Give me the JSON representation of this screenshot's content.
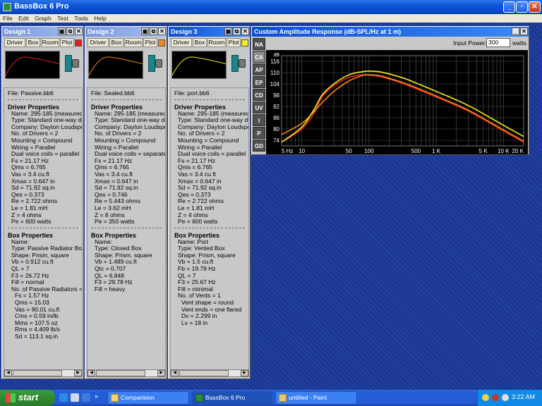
{
  "window": {
    "title": "BassBox 6 Pro"
  },
  "menu": [
    "File",
    "Edit",
    "Graph",
    "Test",
    "Tools",
    "Help"
  ],
  "tabs": [
    "Driver",
    "Box",
    "Room",
    "Plot"
  ],
  "colors": {
    "design1": "#e02020",
    "design2": "#f28a1a",
    "design3": "#f4ee25"
  },
  "designs": [
    {
      "title": "Design 1",
      "file": "File:  Passive.bb6",
      "driver_header": "Driver Properties",
      "driver": [
        "Name:  295-185  (measured)",
        "Type:  Standard one-way driver",
        "Company:  Dayton Loudspeaker",
        "No. of Drivers = 2",
        "Mounting = Compound",
        "Wiring = Parallel",
        "Dual voice coils = parallel",
        "Fs = 21.17 Hz",
        "Qms = 6.765",
        "Vas = 3.4 cu.ft",
        "Xmax = 0.647 in",
        "Sd = 71.92 sq.in",
        "Qes = 0.373",
        "Re = 2.722 ohms",
        "Le = 1.81 mH",
        "Z = 4 ohms",
        "Pe = 600 watts"
      ],
      "box_header": "Box Properties",
      "box": [
        "Name:",
        "Type:  Passive Radiator Box",
        "Shape:  Prism, square",
        "Vb = 0.912 cu.ft",
        "QL = 7",
        "F3 = 26.72 Hz",
        "Fill = normal",
        "No. of Passive Radiators = 2"
      ],
      "box_sub": [
        "Fs = 1.57 Hz",
        "Qms = 15.03",
        "Vas = 90.01 cu.ft",
        "Cms = 0.59 in/lb",
        "Mms = 107.5 oz",
        "Rms = 4.409 lb/s",
        "Sd = 113.1 sq.in"
      ]
    },
    {
      "title": "Design 2",
      "file": "File:  Sealed.bb6",
      "driver_header": "Driver Properties",
      "driver": [
        "Name:  295-185  (measured)",
        "Type:  Standard one-way driver",
        "Company:  Dayton Loudspeaker",
        "No. of Drivers = 2",
        "Mounting = Compound",
        "Wiring = Parallel",
        "Dual voice coils = separate",
        "Fs = 21.17 Hz",
        "Qms = 6.765",
        "Vas = 3.4 cu.ft",
        "Xmax = 0.647 in",
        "Sd = 71.92 sq.in",
        "Qes = 0.746",
        "Re = 5.443 ohms",
        "Le = 3.62 mH",
        "Z = 8 ohms",
        "Pe = 350 watts"
      ],
      "box_header": "Box Properties",
      "box": [
        "Name:",
        "Type:  Closed Box",
        "Shape:  Prism, square",
        "Vb = 1.489 cu.ft",
        "Qtc = 0.707",
        "QL = 6.848",
        "F3 = 29.78 Hz",
        "Fill = heavy"
      ],
      "box_sub": []
    },
    {
      "title": "Design 3",
      "file": "File:  port.bb6",
      "driver_header": "Driver Properties",
      "driver": [
        "Name:  295-185  (measured)",
        "Type:  Standard one-way driver",
        "Company:  Dayton Loudspeaker",
        "No. of Drivers = 2",
        "Mounting = Compound",
        "Wiring = Parallel",
        "Dual voice coils = parallel",
        "Fs = 21.17 Hz",
        "Qms = 6.765",
        "Vas = 3.4 cu.ft",
        "Xmax = 0.647 in",
        "Sd = 71.92 sq.in",
        "Qes = 0.373",
        "Re = 2.722 ohms",
        "Le = 1.81 mH",
        "Z = 4 ohms",
        "Pe = 600 watts"
      ],
      "box_header": "Box Properties",
      "box": [
        "Name:  Port",
        "Type:  Vented Box",
        "Shape:  Prism, square",
        "Vb = 1.5 cu.ft",
        "Fb = 19.79 Hz",
        "QL = 7",
        "F3 = 25.67 Hz",
        "Fill = minimal",
        "No. of Vents = 1"
      ],
      "box_sub": [
        "Vent shape = round",
        "Vent ends = one flared",
        "Dv = 2.299 in",
        "Lv = 18 in"
      ]
    }
  ],
  "graph": {
    "title": "Custom Amplitude Response (dB-SPL/Hz at 1 m)",
    "side_buttons": [
      "NA",
      "CA",
      "AP",
      "EP",
      "CD",
      "UV",
      "I",
      "P",
      "GD"
    ],
    "active_button": "CA",
    "input_power_label": "Input Power:",
    "input_power_value": "300",
    "input_power_unit": "watts"
  },
  "chart_data": {
    "type": "line",
    "ylabel": "dB",
    "yticks": [
      74,
      80,
      86,
      92,
      98,
      104,
      110,
      116
    ],
    "ylim": [
      71,
      119
    ],
    "xscale": "log",
    "xlim": [
      5,
      20000
    ],
    "xticks": [
      {
        "v": 5,
        "label": "5 Hz"
      },
      {
        "v": 10,
        "label": "10"
      },
      {
        "v": 50,
        "label": "50"
      },
      {
        "v": 100,
        "label": "100"
      },
      {
        "v": 500,
        "label": "500"
      },
      {
        "v": 1000,
        "label": "1 K"
      },
      {
        "v": 5000,
        "label": "5 K"
      },
      {
        "v": 10000,
        "label": "10 K"
      },
      {
        "v": 20000,
        "label": "20 K"
      }
    ],
    "grid": true,
    "series": [
      {
        "color": "#e02020",
        "x": [
          5,
          10,
          15,
          20,
          30,
          50,
          80,
          100,
          150,
          300,
          500,
          1000,
          3000,
          10000,
          20000
        ],
        "y": [
          73,
          80,
          88,
          97,
          103,
          107.5,
          108.8,
          108.6,
          107.8,
          104.5,
          101.5,
          97,
          89.5,
          79,
          73
        ]
      },
      {
        "color": "#f28a1a",
        "x": [
          5,
          10,
          15,
          20,
          30,
          50,
          80,
          100,
          150,
          300,
          500,
          1000,
          3000,
          10000,
          20000
        ],
        "y": [
          77,
          83,
          89,
          94,
          100,
          105.5,
          108.5,
          108.8,
          108.2,
          105,
          102,
          97.5,
          90,
          79.5,
          73.5
        ]
      },
      {
        "color": "#f4ee25",
        "x": [
          5,
          10,
          15,
          20,
          30,
          50,
          80,
          100,
          150,
          300,
          500,
          1000,
          3000,
          10000,
          20000
        ],
        "y": [
          73,
          81,
          90,
          98,
          104,
          108.8,
          110.5,
          110.8,
          110.3,
          107.5,
          104.5,
          100,
          92.5,
          82,
          76
        ]
      }
    ]
  },
  "taskbar": {
    "start": "start",
    "buttons": [
      {
        "label": "Comparision"
      },
      {
        "label": "BassBox 6 Pro"
      },
      {
        "label": "untitled - Paint"
      }
    ],
    "clock": "3:22 AM"
  }
}
